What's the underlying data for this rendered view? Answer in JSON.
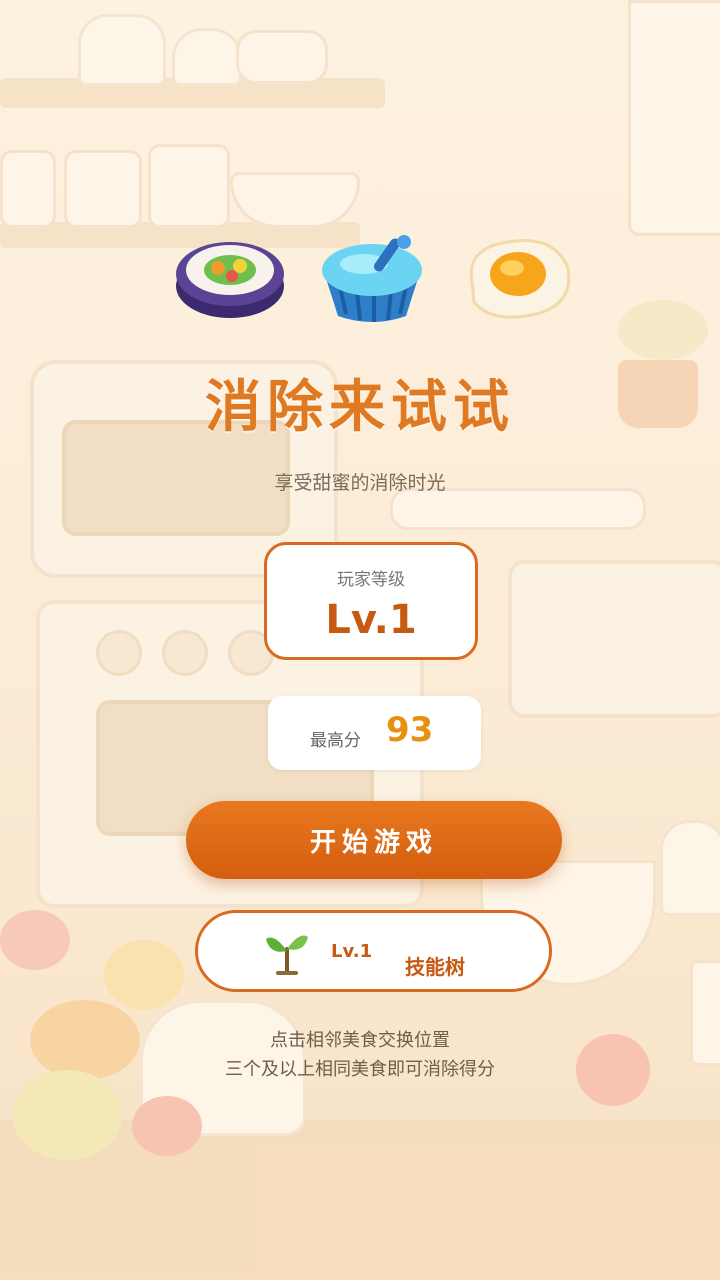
{
  "game": {
    "title": "消除来试试",
    "subtitle": "享受甜蜜的消除时光",
    "featured_foods": [
      "sushi-roll-icon",
      "blue-pudding-icon",
      "fried-egg-icon"
    ]
  },
  "player": {
    "level_label": "玩家等级",
    "level_value": "Lv.1",
    "best_score_label": "最高分",
    "best_score_value": "93"
  },
  "buttons": {
    "start_label": "开始游戏",
    "skill_level": "Lv.1",
    "skill_label": "技能树",
    "skill_icon": "sprout-icon"
  },
  "hints": {
    "line1": "点击相邻美食交换位置",
    "line2": "三个及以上相同美食即可消除得分"
  },
  "colors": {
    "accent": "#e07a22",
    "button": "#d86a22",
    "score": "#e7910f",
    "background": "#fbecd6"
  }
}
